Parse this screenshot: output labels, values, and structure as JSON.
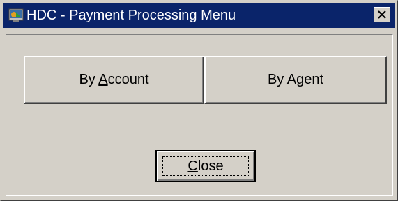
{
  "window": {
    "title": "HDC - Payment Processing Menu",
    "icon": "app-icon",
    "close_symbol": "×"
  },
  "buttons": {
    "by_account": {
      "pre": "By ",
      "mnemonic": "A",
      "post": "ccount"
    },
    "by_agent": {
      "label": "By Agent"
    },
    "close": {
      "pre": "",
      "mnemonic": "C",
      "post": "lose"
    }
  },
  "colors": {
    "titlebar": "#0a246a",
    "face": "#d4d0c8"
  }
}
